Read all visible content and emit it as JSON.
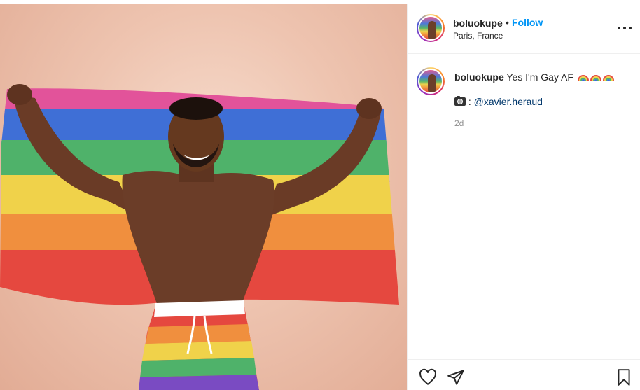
{
  "post": {
    "author": {
      "username": "boluokupe",
      "dot": "•",
      "follow_label": "Follow",
      "location": "Paris, France"
    },
    "caption": {
      "username": "boluokupe",
      "text": "Yes I'm Gay AF",
      "emoji": [
        "rainbow-emoji",
        "rainbow-emoji",
        "rainbow-emoji"
      ]
    },
    "credit": {
      "prefix": ":",
      "mention": "@xavier.heraud"
    },
    "timestamp": "2d",
    "icons": {
      "more": "more-options-icon",
      "like": "heart-icon",
      "share": "paper-plane-icon",
      "save": "bookmark-icon",
      "camera": "camera-icon"
    },
    "colors": {
      "link": "#0095f6",
      "mention": "#00376b",
      "muted": "#8e8e8e",
      "background": "#eec4b0"
    }
  }
}
